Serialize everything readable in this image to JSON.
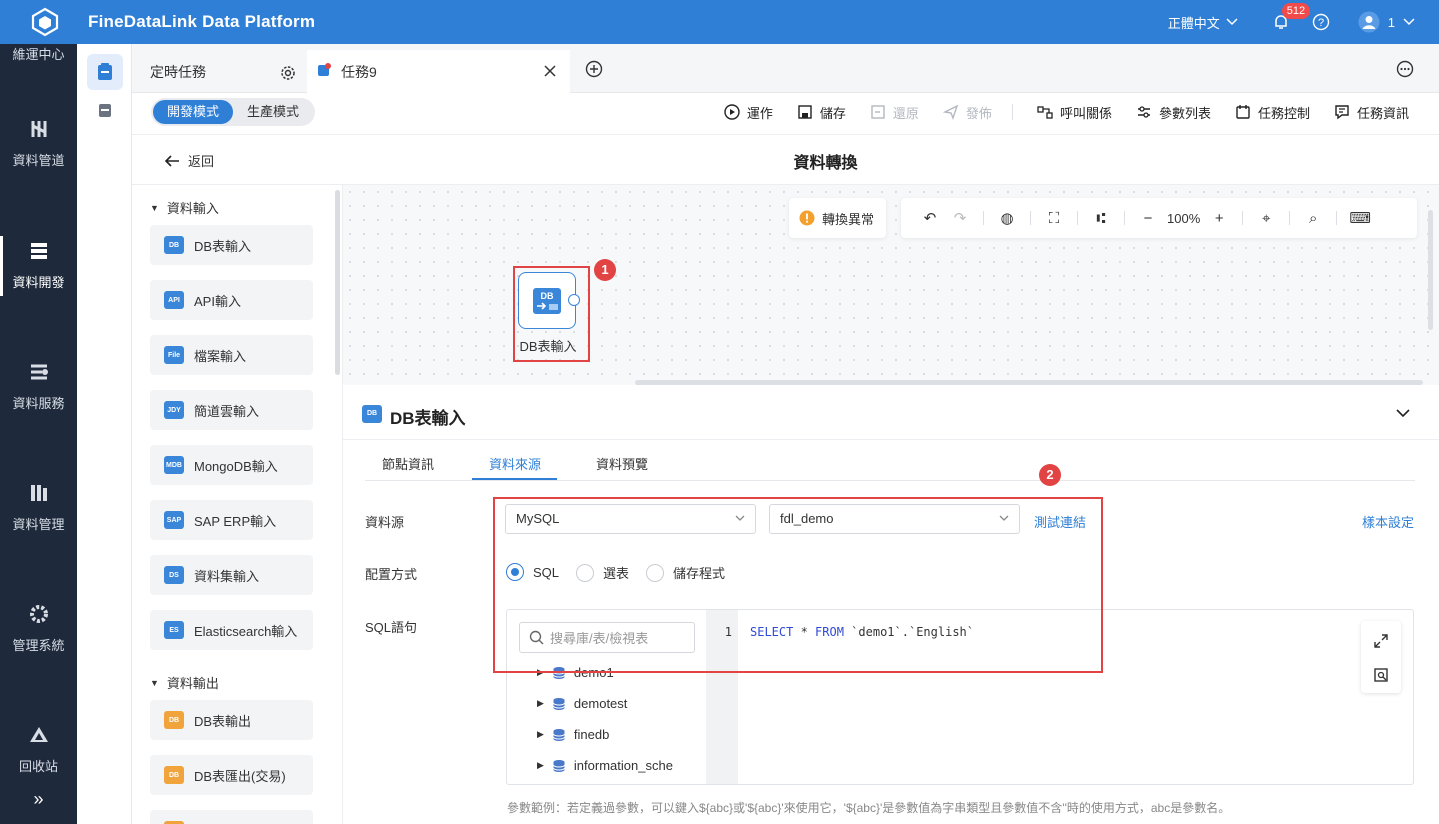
{
  "app": {
    "title": "FineDataLink Data Platform"
  },
  "header": {
    "language": "正體中文",
    "notification_count": "512",
    "user": "1"
  },
  "sidebar": {
    "items": [
      {
        "label": "維運中心"
      },
      {
        "label": "資料管道"
      },
      {
        "label": "資料開發"
      },
      {
        "label": "資料服務"
      },
      {
        "label": "資料管理"
      },
      {
        "label": "管理系統"
      },
      {
        "label": "回收站"
      }
    ],
    "expand_icon": "»"
  },
  "tabs": [
    {
      "label": "定時任務"
    },
    {
      "label": "任務9"
    }
  ],
  "toolbar": {
    "mode_dev": "開發模式",
    "mode_prod": "生產模式",
    "run": "運作",
    "save": "儲存",
    "restore": "還原",
    "publish": "發佈",
    "call_relation": "呼叫關係",
    "param_list": "參數列表",
    "task_control": "任務控制",
    "task_info": "任務資訊"
  },
  "breadcrumb": {
    "back": "返回",
    "title": "資料轉換"
  },
  "palette": {
    "input_group": "資料輸入",
    "inputs": [
      {
        "label": "DB表輸入",
        "icon": "DB"
      },
      {
        "label": "API輸入",
        "icon": "API"
      },
      {
        "label": "檔案輸入",
        "icon": "File"
      },
      {
        "label": "簡道雲輸入",
        "icon": "JDY"
      },
      {
        "label": "MongoDB輸入",
        "icon": "MDB"
      },
      {
        "label": "SAP ERP輸入",
        "icon": "SAP"
      },
      {
        "label": "資料集輸入",
        "icon": "DS"
      },
      {
        "label": "Elasticsearch輸入",
        "icon": "ES"
      }
    ],
    "output_group": "資料輸出",
    "outputs": [
      {
        "label": "DB表輸出",
        "icon": "DB"
      },
      {
        "label": "DB表匯出(交易)",
        "icon": "DB"
      }
    ]
  },
  "canvas": {
    "alert": "轉換異常",
    "zoom": "100%",
    "node_label": "DB表輸入",
    "node_icon": "DB",
    "marker1": "1",
    "marker2": "2"
  },
  "panel": {
    "title": "DB表輸入",
    "tabs": [
      {
        "label": "節點資訊"
      },
      {
        "label": "資料來源"
      },
      {
        "label": "資料預覽"
      }
    ],
    "datasource_label": "資料源",
    "datasource_value": "MySQL",
    "database_value": "fdl_demo",
    "test_link": "測試連結",
    "sample_link": "樣本設定",
    "config_label": "配置方式",
    "radio_sql": "SQL",
    "radio_table": "選表",
    "radio_proc": "儲存程式",
    "sql_label": "SQL語句",
    "search_placeholder": "搜尋庫/表/檢視表",
    "tree": [
      {
        "label": "demo1"
      },
      {
        "label": "demotest"
      },
      {
        "label": "finedb"
      },
      {
        "label": "information_sche"
      }
    ],
    "line_no": "1",
    "sql_kw1": "SELECT",
    "sql_mid": " * ",
    "sql_kw2": "FROM",
    "sql_rest": " `demo1`.`English`",
    "hint": "參數範例：若定義過參數，可以鍵入${abc}或'${abc}'來使用它，'${abc}'是參數值為字串類型且參數值不含''時的使用方式，abc是參數名。"
  },
  "colors": {
    "primary": "#2f7fd6",
    "sidebar": "#1e2a3b",
    "highlight": "#e24343"
  }
}
